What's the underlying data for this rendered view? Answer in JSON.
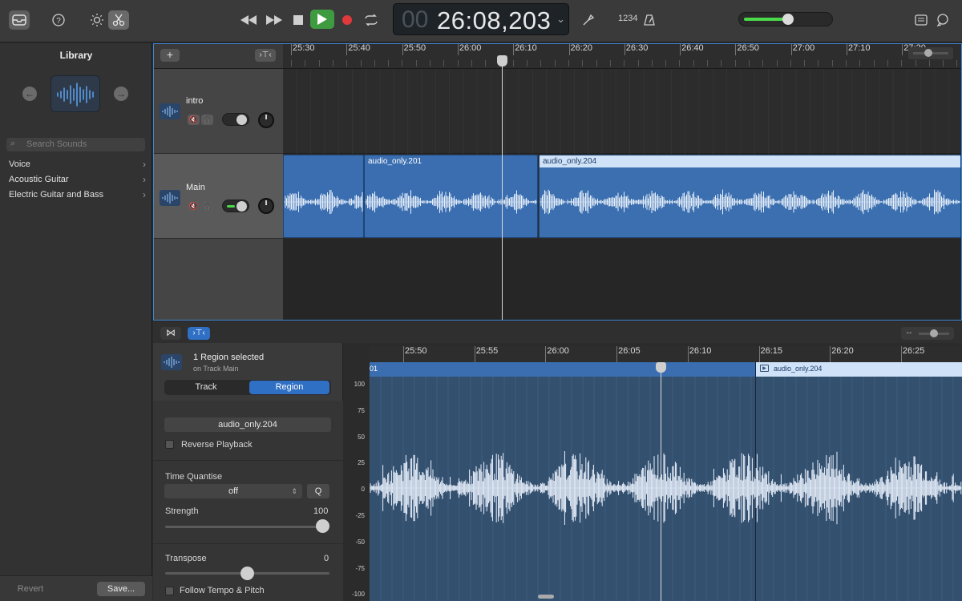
{
  "toolbar": {
    "time_dim": "00",
    "time": "26:08,203",
    "count_in": "1234"
  },
  "library": {
    "title": "Library",
    "search_placeholder": "Search Sounds",
    "items": [
      "Voice",
      "Acoustic Guitar",
      "Electric Guitar and Bass"
    ],
    "revert_label": "Revert",
    "save_label": "Save..."
  },
  "tracks": {
    "ruler_labels": [
      "25:30",
      "25:40",
      "25:50",
      "26:00",
      "26:10",
      "26:20",
      "26:30",
      "26:40",
      "26:50",
      "27:00",
      "27:10",
      "27:20"
    ],
    "items": [
      {
        "name": "intro",
        "monitoring": false
      },
      {
        "name": "Main",
        "monitoring": true
      }
    ],
    "regions": [
      {
        "label": ""
      },
      {
        "label": "audio_only.201"
      },
      {
        "label": "audio_only.204"
      }
    ]
  },
  "editor": {
    "region_count_label": "1 Region selected",
    "track_sub_label": "on Track Main",
    "tab_track": "Track",
    "tab_region": "Region",
    "region_name": "audio_only.204",
    "reverse_label": "Reverse Playback",
    "time_quantise_label": "Time Quantise",
    "time_quantise_value": "off",
    "quantise_button": "Q",
    "strength_label": "Strength",
    "strength_value": "100",
    "transpose_label": "Transpose",
    "transpose_value": "0",
    "follow_label": "Follow Tempo & Pitch",
    "ruler_labels": [
      "25:50",
      "25:55",
      "26:00",
      "26:05",
      "26:10",
      "26:15",
      "26:20",
      "26:25"
    ],
    "y_labels": [
      "100",
      "75",
      "50",
      "25",
      "0",
      "-25",
      "-50",
      "-75",
      "-100"
    ],
    "left_region_label": "01",
    "right_region_label": "audio_only.204"
  },
  "colors": {
    "accent": "#2f6fc4",
    "play": "#3f9b3f",
    "record": "#e0393b",
    "region": "#3a6eb0"
  }
}
